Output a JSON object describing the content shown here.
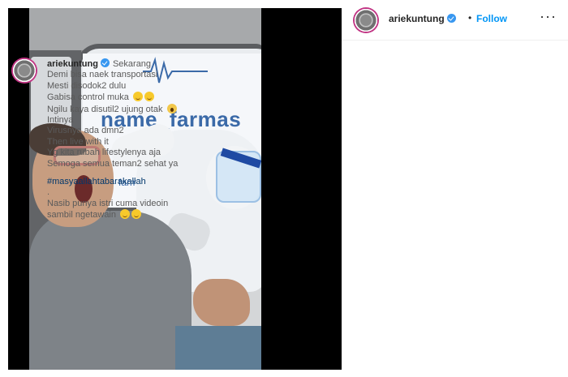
{
  "post": {
    "header": {
      "username": "ariekuntung",
      "separator": "•",
      "follow_label": "Follow",
      "more_icon": "more-options-icon"
    },
    "media": {
      "sign_text": "name_farmas",
      "sign_text_small": "farmasi"
    },
    "caption": {
      "username": "ariekuntung",
      "time": "Sekarang",
      "lines": [
        "Demi bisa naek transportasi",
        "Mesti disodok2 dulu",
        "Gabisa control muka",
        "Ngilu kaya disutil2 ujung otak",
        "Intinya",
        "Virusnya ada dmn2",
        "Then live with it",
        "Yg kita rubah lifestylenya aja",
        "Semoga semua teman2 sehat ya"
      ],
      "hashtag": "#masyaallahtabarakallah",
      "dot_line": ".",
      "lines2": [
        "Nasib punya istri cuma videoin",
        "sambil ngetawain"
      ]
    },
    "colors": {
      "link": "#0095f6",
      "hashtag": "#00376b",
      "verified": "#3897f0"
    }
  }
}
